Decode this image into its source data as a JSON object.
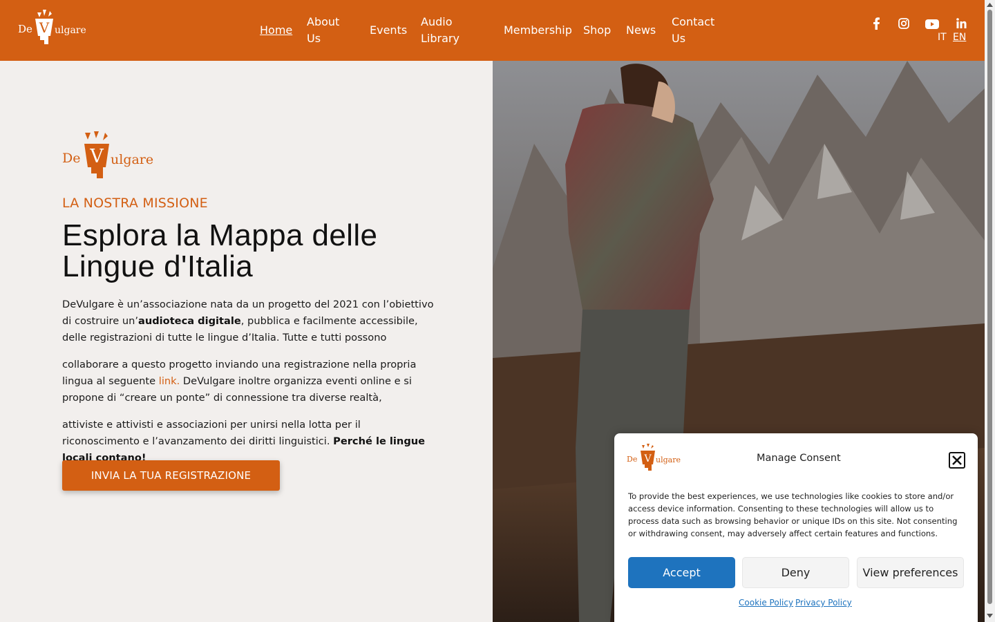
{
  "brand": {
    "logo_name_left": "De",
    "logo_letter": "V",
    "logo_name_right": "ulgare",
    "primary_color": "#d35f13",
    "background_color": "#f2efed"
  },
  "nav": {
    "items": [
      {
        "label": "Home",
        "active": true
      },
      {
        "label": "About Us"
      },
      {
        "label": "Events"
      },
      {
        "label": "Audio Library"
      },
      {
        "label": "Membership"
      },
      {
        "label": "Shop"
      },
      {
        "label": "News"
      },
      {
        "label": "Contact Us"
      }
    ],
    "social_icons": [
      "facebook-icon",
      "instagram-icon",
      "youtube-icon",
      "linkedin-icon"
    ],
    "languages": [
      "IT",
      "EN"
    ],
    "current_language": "EN"
  },
  "hero": {
    "eyebrow": "LA NOSTRA MISSIONE",
    "headline_line1": "Esplora la Mappa delle",
    "headline_line2": "Lingue d'Italia",
    "p1_part1": "DeVulgare è un’associazione nata da un progetto del 2021 con l’obiettivo di costruire un’",
    "p1_bold": "audioteca digitale",
    "p1_part2": ", pubblica e facilmente accessibile, delle registrazioni di tutte le lingue d’Italia. Tutte e tutti possono",
    "p2_part1": "collaborare a questo progetto inviando una registrazione nella propria lingua al seguente ",
    "p2_link": "link.",
    "p2_part2": " DeVulgare inoltre organizza eventi online e si propone di “creare un ponte” di connessione tra diverse realtà,",
    "p3_part1": "attiviste e attivisti e associazioni per unirsi nella lotta per il riconoscimento e l’avanzamento dei diritti linguistici. ",
    "p3_bold": "Perché le lingue locali contano!",
    "cta_label": "INVIA LA TUA REGISTRAZIONE",
    "image_icon": "mountain-photo"
  },
  "consent": {
    "title": "Manage Consent",
    "body": "To provide the best experiences, we use technologies like cookies to store and/or access device information. Consenting to these technologies will allow us to process data such as browsing behavior or unique IDs on this site. Not consenting or withdrawing consent, may adversely affect certain features and functions.",
    "accept_label": "Accept",
    "deny_label": "Deny",
    "preferences_label": "View preferences",
    "cookie_policy_label": "Cookie Policy",
    "privacy_policy_label": "Privacy Policy",
    "accept_color": "#1e73be",
    "close_icon": "close-icon"
  }
}
